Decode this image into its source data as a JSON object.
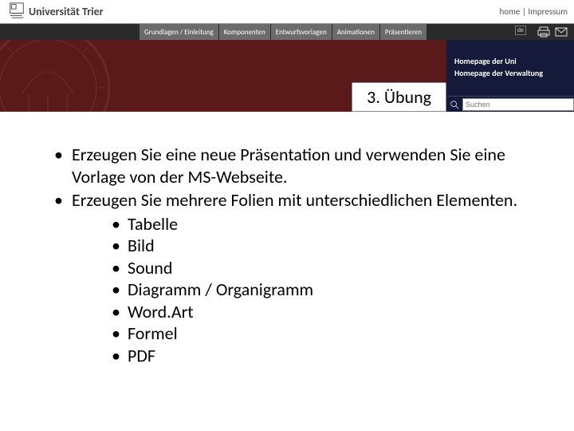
{
  "top": {
    "logo_text": "Universität Trier",
    "home": "home",
    "sep": " | ",
    "impressum": "Impressum"
  },
  "nav": {
    "items": [
      "Grundlagen / Einleitung",
      "Komponenten",
      "Entwurfsvorlagen",
      "Animationen",
      "Präsentieren"
    ],
    "lang": "de"
  },
  "banner": {
    "title": "3. Übung",
    "right_links": [
      "Homepage der Uni",
      "Homepage der Verwaltung"
    ],
    "search_placeholder": "Suchen"
  },
  "content": {
    "bullets": [
      "Erzeugen Sie eine neue Präsentation und verwenden Sie eine Vorlage von der MS-Webseite.",
      "Erzeugen Sie mehrere Folien mit unterschiedlichen Elementen."
    ],
    "sub": [
      "Tabelle",
      "Bild",
      "Sound",
      "Diagramm / Organigramm",
      "Word.Art",
      "Formel",
      "PDF"
    ]
  }
}
